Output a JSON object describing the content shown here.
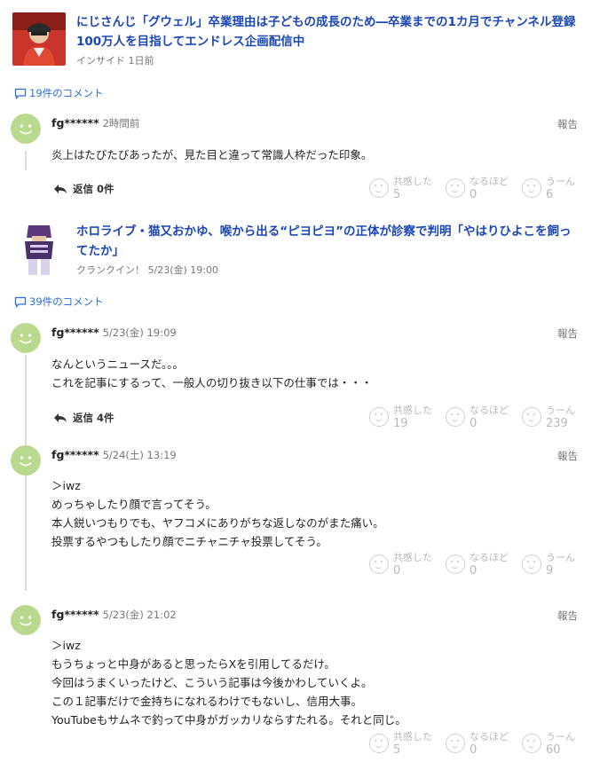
{
  "articles": [
    {
      "title": "にじさんじ「グウェル」卒業理由は子どもの成長のため―卒業までの1カ月でチャンネル登録100万人を目指してエンドレス企画配信中",
      "source": "インサイド",
      "time": "1日前",
      "comment_count": "19件のコメント",
      "comments": [
        {
          "user": "fg******",
          "time": "2時間前",
          "report": "報告",
          "body": "炎上はたびたびあったが、見た目と違って常識人枠だった印象。",
          "reply": "返信 0件",
          "reactions": [
            {
              "label": "共感した",
              "count": "5"
            },
            {
              "label": "なるほど",
              "count": "0"
            },
            {
              "label": "うーん",
              "count": "6"
            }
          ]
        }
      ]
    },
    {
      "title": "ホロライブ・猫又おかゆ、喉から出る“ピヨピヨ”の正体が診察で判明「やはりひよこを飼ってたか」",
      "source": "クランクイン！",
      "time": "5/23(金) 19:00",
      "comment_count": "39件のコメント",
      "comments": [
        {
          "user": "fg******",
          "time": "5/23(金) 19:09",
          "report": "報告",
          "body": "なんというニュースだ。。。\nこれを記事にするって、一般人の切り抜き以下の仕事では・・・",
          "reply": "返信 4件",
          "reactions": [
            {
              "label": "共感した",
              "count": "19"
            },
            {
              "label": "なるほど",
              "count": "0"
            },
            {
              "label": "うーん",
              "count": "239"
            }
          ]
        },
        {
          "user": "fg******",
          "time": "5/24(土) 13:19",
          "report": "報告",
          "body": "＞iwz\nめっちゃしたり顔で言ってそう。\n本人鋭いつもりでも、ヤフコメにありがちな返しなのがまた痛い。\n投票するやつもしたり顔でニチャニチャ投票してそう。",
          "reactions": [
            {
              "label": "共感した",
              "count": "0"
            },
            {
              "label": "なるほど",
              "count": "0"
            },
            {
              "label": "うーん",
              "count": "9"
            }
          ]
        },
        {
          "user": "fg******",
          "time": "5/23(金) 21:02",
          "report": "報告",
          "body": "＞iwz\nもうちょっと中身があると思ったらXを引用してるだけ。\n今回はうまくいったけど、こういう記事は今後かわしていくよ。\nこの１記事だけで金持ちになれるわけでもないし、信用大事。\nYouTubeもサムネで釣って中身がガッカリならすたれる。それと同じ。",
          "reactions": [
            {
              "label": "共感した",
              "count": "5"
            },
            {
              "label": "なるほど",
              "count": "0"
            },
            {
              "label": "うーん",
              "count": "60"
            }
          ]
        }
      ]
    }
  ],
  "colors": {
    "link": "#1a47b8",
    "accent": "#2a6fd8",
    "avatar": "#b9d98f"
  }
}
